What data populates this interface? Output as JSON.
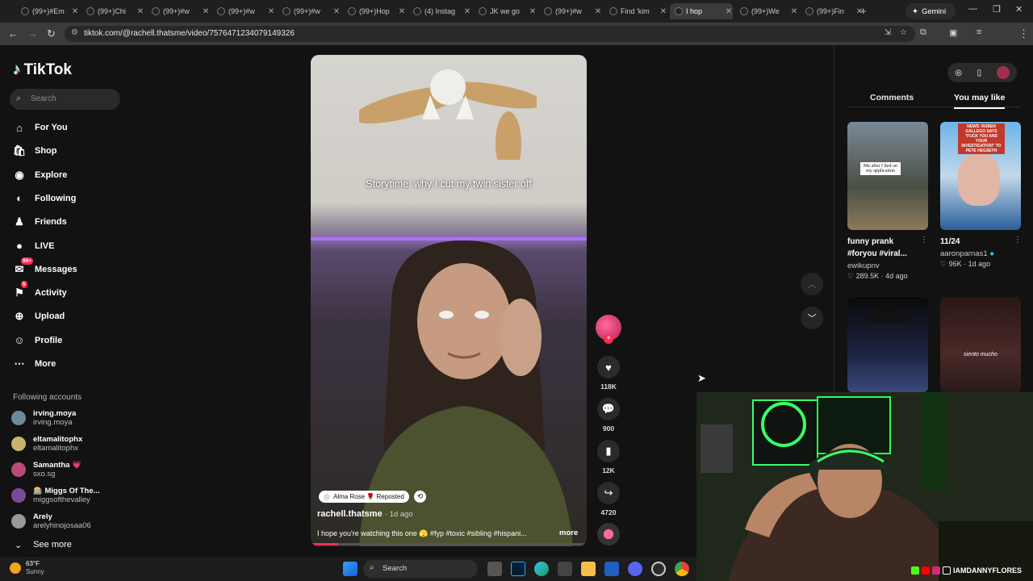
{
  "browser": {
    "tabs": [
      {
        "title": "(99+)#Em"
      },
      {
        "title": "(99+)Chi"
      },
      {
        "title": "(99+)#w"
      },
      {
        "title": "(99+)#w"
      },
      {
        "title": "(99+)#w"
      },
      {
        "title": "(99+)Hop"
      },
      {
        "title": "(4) Instag"
      },
      {
        "title": "JK we go"
      },
      {
        "title": "(99+)#w"
      },
      {
        "title": "Find 'kim"
      },
      {
        "title": "I hop"
      },
      {
        "title": "(99+)We"
      },
      {
        "title": "(99+)Fin"
      }
    ],
    "active_tab_index": 10,
    "gemini_label": "Gemini",
    "url": "tiktok.com/@rachell.thatsme/video/7576471234079149326"
  },
  "tiktok": {
    "logo_text": "TikTok",
    "search_placeholder": "Search",
    "nav": [
      {
        "label": "For You",
        "icon": "home-icon"
      },
      {
        "label": "Shop",
        "icon": "shop-icon"
      },
      {
        "label": "Explore",
        "icon": "explore-icon"
      },
      {
        "label": "Following",
        "icon": "following-icon"
      },
      {
        "label": "Friends",
        "icon": "friends-icon"
      },
      {
        "label": "LIVE",
        "icon": "live-icon"
      },
      {
        "label": "Messages",
        "icon": "messages-icon",
        "badge": "99+"
      },
      {
        "label": "Activity",
        "icon": "activity-icon",
        "badge": "5"
      },
      {
        "label": "Upload",
        "icon": "upload-icon"
      },
      {
        "label": "Profile",
        "icon": "profile-icon"
      },
      {
        "label": "More",
        "icon": "more-icon"
      }
    ],
    "following_title": "Following accounts",
    "following": [
      {
        "name": "irving.moya",
        "handle": "irving.moya"
      },
      {
        "name": "eltamalitophx",
        "handle": "eltamalitophx"
      },
      {
        "name": "Samantha 💗",
        "handle": "sxo.sg"
      },
      {
        "name": "🎰 Miggs Of The...",
        "handle": "miggsofthevalley"
      },
      {
        "name": "Arely",
        "handle": "arelyhinojosaa06"
      }
    ],
    "see_more": "See more",
    "video": {
      "overlay_text": "Storytime: why I cut my twin sister off",
      "repost_chip": "Alma Rose 🌹 Reposted",
      "author": "rachell.thatsme",
      "time": "· 1d ago",
      "description": "I hope you're watching this one 🫣 #fyp #toxic #sibling #hispani...",
      "more": "more",
      "progress": 0.1
    },
    "actions": {
      "likes": "118K",
      "comments": "900",
      "saves": "12K",
      "shares": "4720"
    },
    "right_panel": {
      "tab_comments": "Comments",
      "tab_you_may_like": "You may like",
      "thumbs": [
        {
          "title": "funny prank #foryou #viral...",
          "user": "ewikupnv",
          "stats": "♡ 289.5K · 4d ago",
          "overlay": "Me after I lied on my application"
        },
        {
          "title": "11/24",
          "user": "aaronparnas1",
          "stats": "♡ 96K · 1d ago",
          "overlay": "NEWS: RUBEN GALLEGO SAYS \"FUCK YOU AND YOUR INVESTIGATION\" TO PETE HEGSETH"
        },
        {
          "title": "",
          "user": "",
          "stats": "",
          "overlay": ""
        },
        {
          "title": "",
          "user": "",
          "stats": "",
          "overlay": "siento mucho"
        }
      ]
    }
  },
  "webcam": {
    "handle": "IAMDANNYFLORES"
  },
  "taskbar": {
    "temp": "63°F",
    "condition": "Sunny",
    "search_placeholder": "Search"
  },
  "colors": {
    "accent": "#fe2c55",
    "background": "#121212"
  }
}
